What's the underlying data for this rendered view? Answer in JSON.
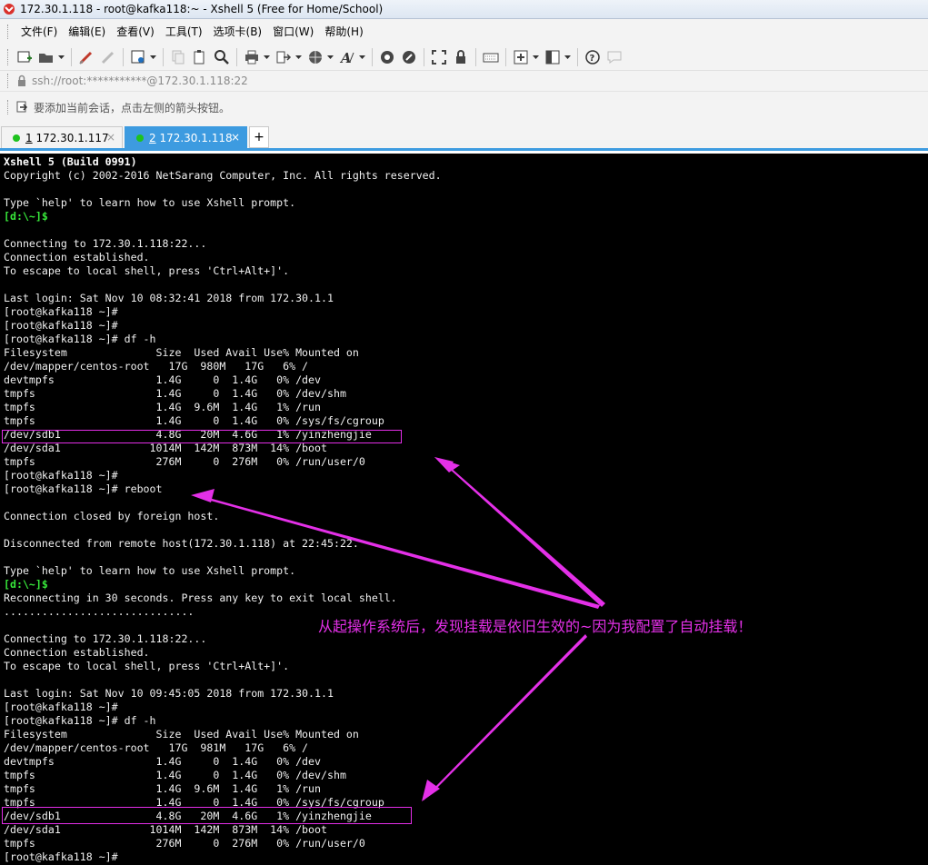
{
  "window": {
    "title": "172.30.1.118 - root@kafka118:~ - Xshell 5 (Free for Home/School)"
  },
  "menu": [
    "文件(F)",
    "编辑(E)",
    "查看(V)",
    "工具(T)",
    "选项卡(B)",
    "窗口(W)",
    "帮助(H)"
  ],
  "toolbar": {
    "icons": [
      "new-session-icon",
      "open-folder-icon",
      "reconnect-icon",
      "disconnect-icon",
      "properties-icon",
      "copy-icon",
      "paste-icon",
      "find-icon",
      "print-icon",
      "transfer-icon",
      "globe-icon",
      "font-icon",
      "xftp-icon",
      "xmanager-icon",
      "fullscreen-icon",
      "lock-icon",
      "keyboard-icon",
      "add-icon",
      "layout-icon",
      "help-icon",
      "chat-icon"
    ]
  },
  "address": {
    "text": "ssh://root:***********@172.30.1.118:22"
  },
  "hint": {
    "text": "要添加当前会话，点击左侧的箭头按钮。"
  },
  "tabs": [
    {
      "num": "1",
      "label": " 172.30.1.117",
      "close": "×",
      "status_color": "#1ec21e"
    },
    {
      "num": "2",
      "label": " 172.30.1.118",
      "close": "×",
      "status_color": "#1ec21e"
    }
  ],
  "tab_add": "+",
  "terminal": {
    "lines": [
      {
        "text": "Xshell 5 (Build 0991)",
        "style": "bold"
      },
      {
        "text": "Copyright (c) 2002-2016 NetSarang Computer, Inc. All rights reserved."
      },
      {
        "text": ""
      },
      {
        "text": "Type `help' to learn how to use Xshell prompt."
      },
      {
        "text": "[d:\\~]$",
        "style": "green"
      },
      {
        "text": ""
      },
      {
        "text": "Connecting to 172.30.1.118:22..."
      },
      {
        "text": "Connection established."
      },
      {
        "text": "To escape to local shell, press 'Ctrl+Alt+]'."
      },
      {
        "text": ""
      },
      {
        "text": "Last login: Sat Nov 10 08:32:41 2018 from 172.30.1.1"
      },
      {
        "text": "[root@kafka118 ~]#"
      },
      {
        "text": "[root@kafka118 ~]#"
      },
      {
        "text": "[root@kafka118 ~]# df -h"
      },
      {
        "text": "Filesystem              Size  Used Avail Use% Mounted on"
      },
      {
        "text": "/dev/mapper/centos-root   17G  980M   17G   6% /"
      },
      {
        "text": "devtmpfs                1.4G     0  1.4G   0% /dev"
      },
      {
        "text": "tmpfs                   1.4G     0  1.4G   0% /dev/shm"
      },
      {
        "text": "tmpfs                   1.4G  9.6M  1.4G   1% /run"
      },
      {
        "text": "tmpfs                   1.4G     0  1.4G   0% /sys/fs/cgroup"
      },
      {
        "text": "/dev/sdb1               4.8G   20M  4.6G   1% /yinzhengjie"
      },
      {
        "text": "/dev/sda1              1014M  142M  873M  14% /boot"
      },
      {
        "text": "tmpfs                   276M     0  276M   0% /run/user/0"
      },
      {
        "text": "[root@kafka118 ~]#"
      },
      {
        "text": "[root@kafka118 ~]# reboot"
      },
      {
        "text": ""
      },
      {
        "text": "Connection closed by foreign host."
      },
      {
        "text": ""
      },
      {
        "text": "Disconnected from remote host(172.30.1.118) at 22:45:22."
      },
      {
        "text": ""
      },
      {
        "text": "Type `help' to learn how to use Xshell prompt."
      },
      {
        "text": "[d:\\~]$",
        "style": "green"
      },
      {
        "text": "Reconnecting in 30 seconds. Press any key to exit local shell."
      },
      {
        "text": ".............................."
      },
      {
        "text": ""
      },
      {
        "text": "Connecting to 172.30.1.118:22..."
      },
      {
        "text": "Connection established."
      },
      {
        "text": "To escape to local shell, press 'Ctrl+Alt+]'."
      },
      {
        "text": ""
      },
      {
        "text": "Last login: Sat Nov 10 09:45:05 2018 from 172.30.1.1"
      },
      {
        "text": "[root@kafka118 ~]#"
      },
      {
        "text": "[root@kafka118 ~]# df -h"
      },
      {
        "text": "Filesystem              Size  Used Avail Use% Mounted on"
      },
      {
        "text": "/dev/mapper/centos-root   17G  981M   17G   6% /"
      },
      {
        "text": "devtmpfs                1.4G     0  1.4G   0% /dev"
      },
      {
        "text": "tmpfs                   1.4G     0  1.4G   0% /dev/shm"
      },
      {
        "text": "tmpfs                   1.4G  9.6M  1.4G   1% /run"
      },
      {
        "text": "tmpfs                   1.4G     0  1.4G   0% /sys/fs/cgroup"
      },
      {
        "text": "/dev/sdb1               4.8G   20M  4.6G   1% /yinzhengjie"
      },
      {
        "text": "/dev/sda1              1014M  142M  873M  14% /boot"
      },
      {
        "text": "tmpfs                   276M     0  276M   0% /run/user/0"
      },
      {
        "text": "[root@kafka118 ~]#"
      }
    ]
  },
  "annotation": {
    "text": "从起操作系统后，发现挂载是依旧生效的~因为我配置了自动挂载！",
    "color": "#e430e8"
  }
}
